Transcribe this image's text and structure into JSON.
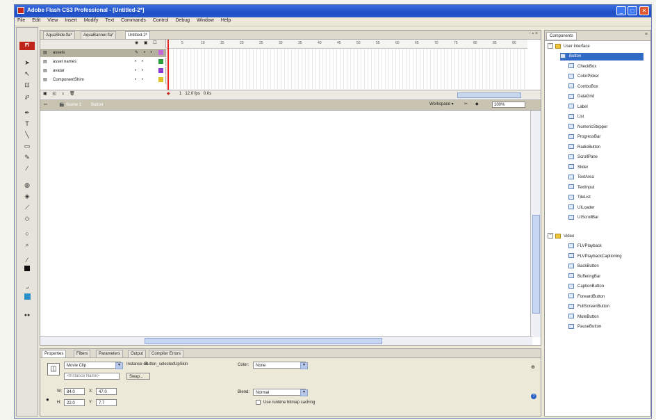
{
  "window": {
    "title": "Adobe Flash CS3 Professional - [Untitled-2*]"
  },
  "menu": [
    "File",
    "Edit",
    "View",
    "Insert",
    "Modify",
    "Text",
    "Commands",
    "Control",
    "Debug",
    "Window",
    "Help"
  ],
  "tools": {
    "logo": "Fl"
  },
  "doc_tabs": [
    "AquaSlide.fla*",
    "AquaBanner.fla*",
    "Untitled-2*"
  ],
  "timeline": {
    "ruler": [
      "5",
      "10",
      "15",
      "20",
      "25",
      "30",
      "35",
      "40",
      "45",
      "50",
      "55",
      "60",
      "65",
      "70",
      "75",
      "80",
      "85",
      "90"
    ],
    "layers": [
      "assets",
      "asset names",
      "avatar",
      "ComponentShim"
    ],
    "footer_fps": "12.0 fps",
    "footer_time": "0.0s",
    "footer_frame": "1"
  },
  "editbar": {
    "scene": "Scene 1",
    "symbol": "Button",
    "workspace": "Workspace ▾",
    "zoom": "100%"
  },
  "properties": {
    "tabs": [
      "Properties",
      "Filters",
      "Parameters",
      "Output",
      "Compiler Errors"
    ],
    "symbol_type": "Movie Clip",
    "instance_of_label": "Instance of:",
    "instance_of": "Button_selectedUpSkin",
    "instance_name_placeholder": "<Instance Name>",
    "swap": "Swap...",
    "color_label": "Color:",
    "color_value": "None",
    "blend_label": "Blend:",
    "blend_value": "Normal",
    "bitmap_caching": "Use runtime bitmap caching",
    "w_label": "W:",
    "w_value": "84.0",
    "x_label": "X:",
    "x_value": "47.0",
    "h_label": "H:",
    "h_value": "22.0",
    "y_label": "Y:",
    "y_value": "7.7"
  },
  "components": {
    "tab": "Components",
    "groups": [
      {
        "name": "User Interface",
        "items": [
          "Button",
          "CheckBox",
          "ColorPicker",
          "ComboBox",
          "DataGrid",
          "Label",
          "List",
          "NumericStepper",
          "ProgressBar",
          "RadioButton",
          "ScrollPane",
          "Slider",
          "TextArea",
          "TextInput",
          "TileList",
          "UILoader",
          "UIScrollBar"
        ]
      },
      {
        "name": "Video",
        "items": [
          "FLVPlayback",
          "FLVPlaybackCaptioning",
          "BackButton",
          "BufferingBar",
          "CaptionButton",
          "ForwardButton",
          "FullScreenButton",
          "MuteButton",
          "PauseButton"
        ]
      }
    ]
  },
  "colors": {
    "selection": "#316ac5",
    "titlebar": "#1f4fc4",
    "flash_red": "#c0241b"
  }
}
